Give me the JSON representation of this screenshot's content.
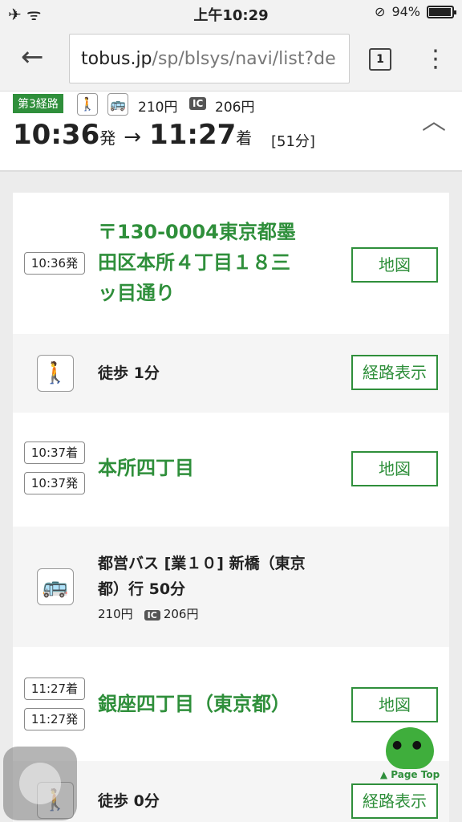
{
  "status_bar": {
    "left_icons": "✈ ᯤ",
    "time": "上午10:29",
    "orientation_lock": "⊘",
    "battery": "94%"
  },
  "browser": {
    "url_domain": "tobus.jp",
    "url_path": "/sp/blsys/navi/list?de",
    "tab_count": "1"
  },
  "route_summary": {
    "badge": "第3経路",
    "fare_cash": "210円",
    "ic_label": "IC",
    "fare_ic": "206円",
    "depart_time": "10:36",
    "depart_suffix": "発",
    "arrow": "→",
    "arrive_time": "11:27",
    "arrive_suffix": "着",
    "duration": "[51分]"
  },
  "steps": {
    "origin": {
      "time_depart": "10:36発",
      "name_lines": [
        "〒130-0004東京都墨",
        "田区本所４丁目１８三",
        "ッ目通り"
      ],
      "button": "地図"
    },
    "walk1": {
      "text": "徒歩 1分",
      "button": "経路表示"
    },
    "stop1": {
      "time_arrive": "10:37着",
      "time_depart": "10:37発",
      "name": "本所四丁目",
      "button": "地図"
    },
    "bus": {
      "line1": "都営バス [業１０] 新橋（東京",
      "line2": "都）行 50分",
      "fare_cash": "210円",
      "ic_label": "IC",
      "fare_ic": "206円"
    },
    "stop2": {
      "time_arrive": "11:27着",
      "time_depart": "11:27発",
      "name": "銀座四丁目（東京都）",
      "button": "地図"
    },
    "walk2": {
      "text": "徒歩 0分",
      "button": "経路表示"
    }
  },
  "page_top": {
    "label": "▲ Page Top"
  },
  "colors": {
    "accent": "#2f8f3b",
    "segment_bg": "#f5f5f5"
  }
}
